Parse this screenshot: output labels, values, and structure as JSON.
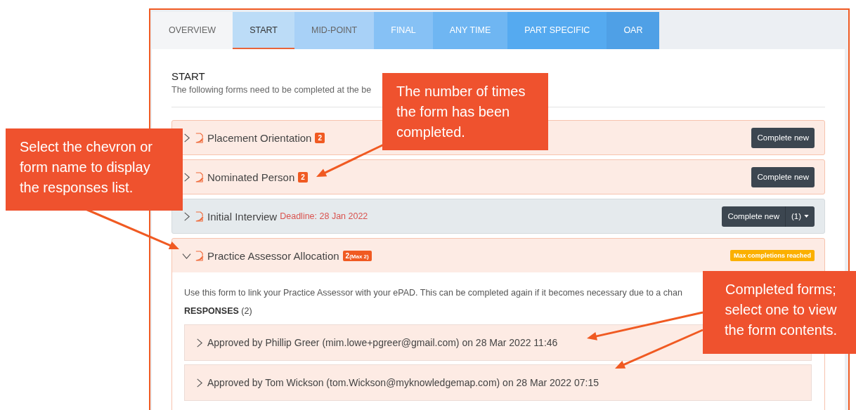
{
  "tabs": [
    {
      "label": "OVERVIEW",
      "selected": false,
      "color": "#f4f5f7"
    },
    {
      "label": "START",
      "selected": true,
      "color": "#bcdcf7"
    },
    {
      "label": "MID-POINT",
      "selected": false,
      "color": "#a8d1f7"
    },
    {
      "label": "FINAL",
      "selected": false,
      "color": "#86c1f5"
    },
    {
      "label": "ANY TIME",
      "selected": false,
      "color": "#6fb6f2"
    },
    {
      "label": "PART SPECIFIC",
      "selected": false,
      "color": "#55aaf0"
    },
    {
      "label": "OAR",
      "selected": false,
      "color": "#4fa0e6"
    }
  ],
  "section": {
    "title": "START",
    "subtitle": "The following forms need to be completed at the be"
  },
  "forms": [
    {
      "name": "Placement Orientation",
      "kind": "done",
      "expanded": false,
      "count": "2",
      "action": {
        "label": "Complete new"
      }
    },
    {
      "name": "Nominated Person",
      "kind": "done",
      "expanded": false,
      "count": "2",
      "action": {
        "label": "Complete new"
      }
    },
    {
      "name": "Initial Interview",
      "kind": "pending",
      "expanded": false,
      "deadline": "Deadline: 28 Jan 2022",
      "action": {
        "label": "Complete new",
        "extra": "(1)"
      }
    },
    {
      "name": "Practice Assessor Allocation",
      "kind": "done",
      "expanded": true,
      "count": "2",
      "count_note": "(Max 2)",
      "status_badge": "Max completions reached",
      "description": "Use this form to link your Practice Assessor with your ePAD. This can be completed again if it becomes necessary due to a chan",
      "responses_label": "RESPONSES",
      "responses_count": "(2)",
      "responses": [
        {
          "text": "Approved by Phillip Greer (mim.lowe+pgreer@gmail.com) on 28 Mar 2022 11:46",
          "expanded": false
        },
        {
          "text": "Approved by Tom Wickson (tom.Wickson@myknowledgemap.com) on 28 Mar 2022 07:15",
          "expanded": false
        }
      ]
    }
  ],
  "callouts": [
    {
      "text": "The number of times the form has been completed."
    },
    {
      "text": "Select the chevron or form name to display the responses list."
    },
    {
      "text": "Completed forms; select one to view the form contents."
    }
  ]
}
